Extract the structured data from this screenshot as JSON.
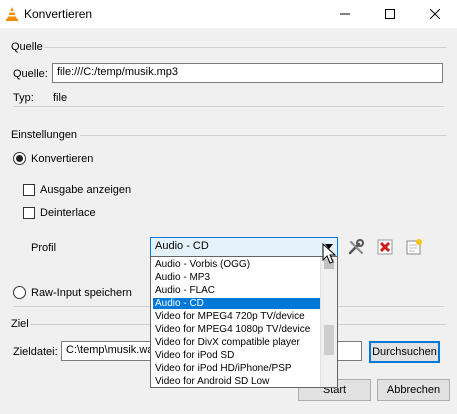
{
  "window": {
    "title": "Konvertieren"
  },
  "source": {
    "group_label": "Quelle",
    "source_label": "Quelle:",
    "source_value": "file:///C:/temp/musik.mp3",
    "type_label": "Typ:",
    "type_value": "file"
  },
  "settings": {
    "group_label": "Einstellungen",
    "convert_label": "Konvertieren",
    "show_output_label": "Ausgabe anzeigen",
    "deinterlace_label": "Deinterlace",
    "profile_label": "Profil",
    "profile_value": "Audio - CD",
    "raw_label": "Raw-Input speichern"
  },
  "profiles": [
    "Audio - Vorbis (OGG)",
    "Audio - MP3",
    "Audio - FLAC",
    "Audio - CD",
    "Video for MPEG4 720p TV/device",
    "Video for MPEG4 1080p TV/device",
    "Video for DivX compatible player",
    "Video for iPod SD",
    "Video for iPod HD/iPhone/PSP",
    "Video for Android SD Low"
  ],
  "target": {
    "group_label": "Ziel",
    "file_label": "Zieldatei:",
    "file_value": "C:\\temp\\musik.wav",
    "browse_label": "Durchsuchen"
  },
  "buttons": {
    "start": "Start",
    "cancel": "Abbrechen"
  },
  "icons": {
    "app": "vlc-cone-icon",
    "edit": "wrench-icon",
    "delete": "red-x-icon",
    "new": "new-profile-icon"
  }
}
